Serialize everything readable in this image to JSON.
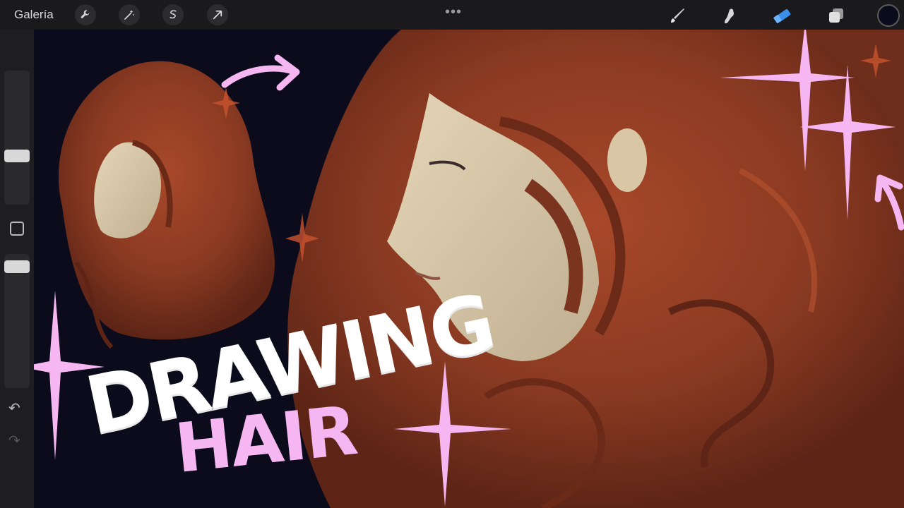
{
  "toolbar": {
    "gallery_label": "Galería",
    "left_tools": [
      "wrench-icon",
      "magic-wand-icon",
      "selection-icon",
      "transform-arrow-icon"
    ],
    "more_label": "•••",
    "right_tools": [
      "brush-icon",
      "smudge-icon",
      "eraser-icon",
      "layers-icon"
    ],
    "active_tool": "eraser-icon",
    "color": "#0b0b1c"
  },
  "sidebar": {
    "undo_label": "↶",
    "redo_label": "↷",
    "brush_size_level": 0.35,
    "opacity_level": 0.95
  },
  "artwork": {
    "title_line1": "DRAWING",
    "title_line2": "HAIR",
    "title_color": "#ffffff",
    "accent_color": "#f6b6f2",
    "hair_color": "#8a3a22",
    "background_color": "#0b0b1c"
  }
}
